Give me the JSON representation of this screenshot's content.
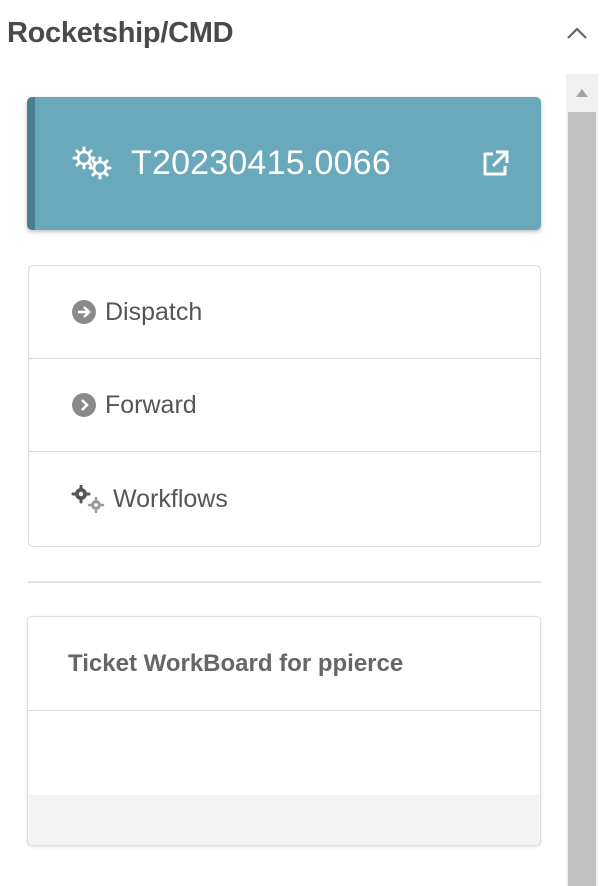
{
  "header": {
    "title": "Rocketship/CMD",
    "collapse_icon": "chevron-up-icon"
  },
  "ticket": {
    "number": "T20230415.0066",
    "icon": "gears-icon",
    "link_icon": "external-link-icon",
    "background_color": "#6aa8bb",
    "accent_color": "#4b7f8f"
  },
  "actions": [
    {
      "label": "Dispatch",
      "icon": "arrow-circle-right-icon"
    },
    {
      "label": "Forward",
      "icon": "chevron-circle-right-icon"
    },
    {
      "label": "Workflows",
      "icon": "gears-icon"
    }
  ],
  "workboard": {
    "title": "Ticket WorkBoard for ppierce"
  }
}
